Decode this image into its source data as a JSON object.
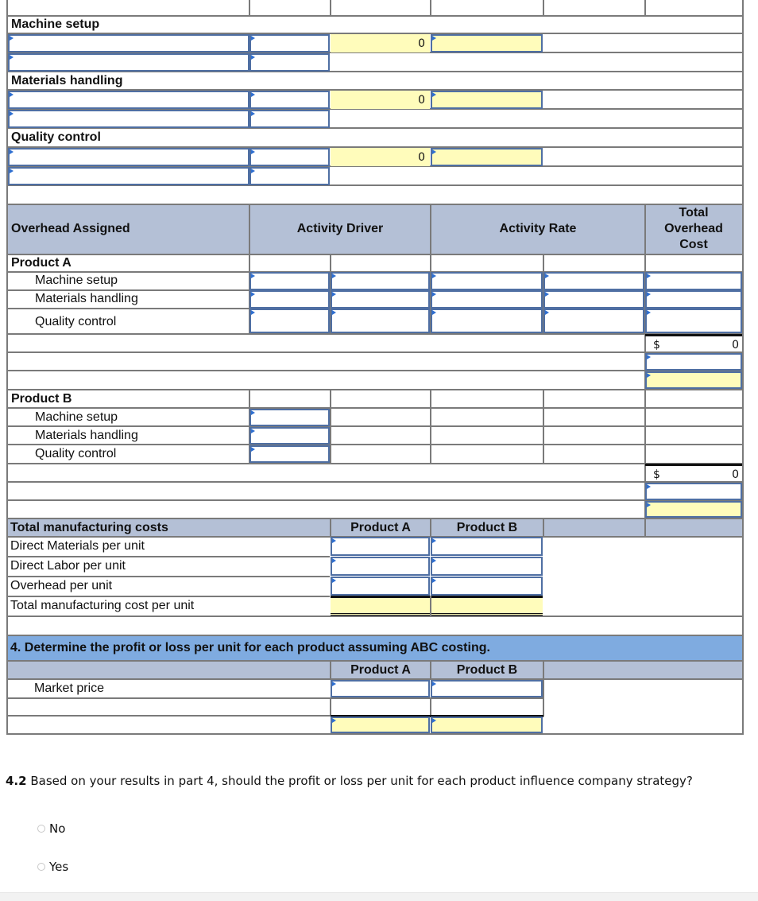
{
  "top_section": {
    "activities": [
      {
        "label": "Machine setup",
        "computed_value": "0"
      },
      {
        "label": "Materials handling",
        "computed_value": "0"
      },
      {
        "label": "Quality control",
        "computed_value": "0"
      }
    ]
  },
  "overhead_assigned": {
    "headers": {
      "col1": "Overhead Assigned",
      "col2": "Activity Driver",
      "col3": "Activity Rate",
      "col4": "Total Overhead Cost"
    },
    "products": [
      {
        "name": "Product A",
        "activities": [
          "Machine setup",
          "Materials handling",
          "Quality control"
        ],
        "total_currency": "$",
        "total_value": "0"
      },
      {
        "name": "Product B",
        "activities": [
          "Machine setup",
          "Materials handling",
          "Quality control"
        ],
        "total_currency": "$",
        "total_value": "0"
      }
    ]
  },
  "manufacturing_costs": {
    "header": "Total manufacturing costs",
    "col_a": "Product A",
    "col_b": "Product B",
    "rows": [
      "Direct Materials per unit",
      "Direct Labor per unit",
      "Overhead per unit",
      "Total manufacturing cost per unit"
    ]
  },
  "part4": {
    "title": "4. Determine the profit or loss per unit for each product assuming ABC costing.",
    "col_a": "Product A",
    "col_b": "Product B",
    "rows": [
      "Market price"
    ]
  },
  "question": {
    "number": "4.2",
    "text": " Based on your results in part 4, should the profit or loss per unit for each product influence company strategy?",
    "options": [
      "No",
      "Yes"
    ]
  },
  "colors": {
    "header_bg": "#b4c0d6",
    "section_header_bg": "#7fabe0",
    "computed_cell_bg": "#fffcbb",
    "input_border": "#4f6fa3"
  }
}
